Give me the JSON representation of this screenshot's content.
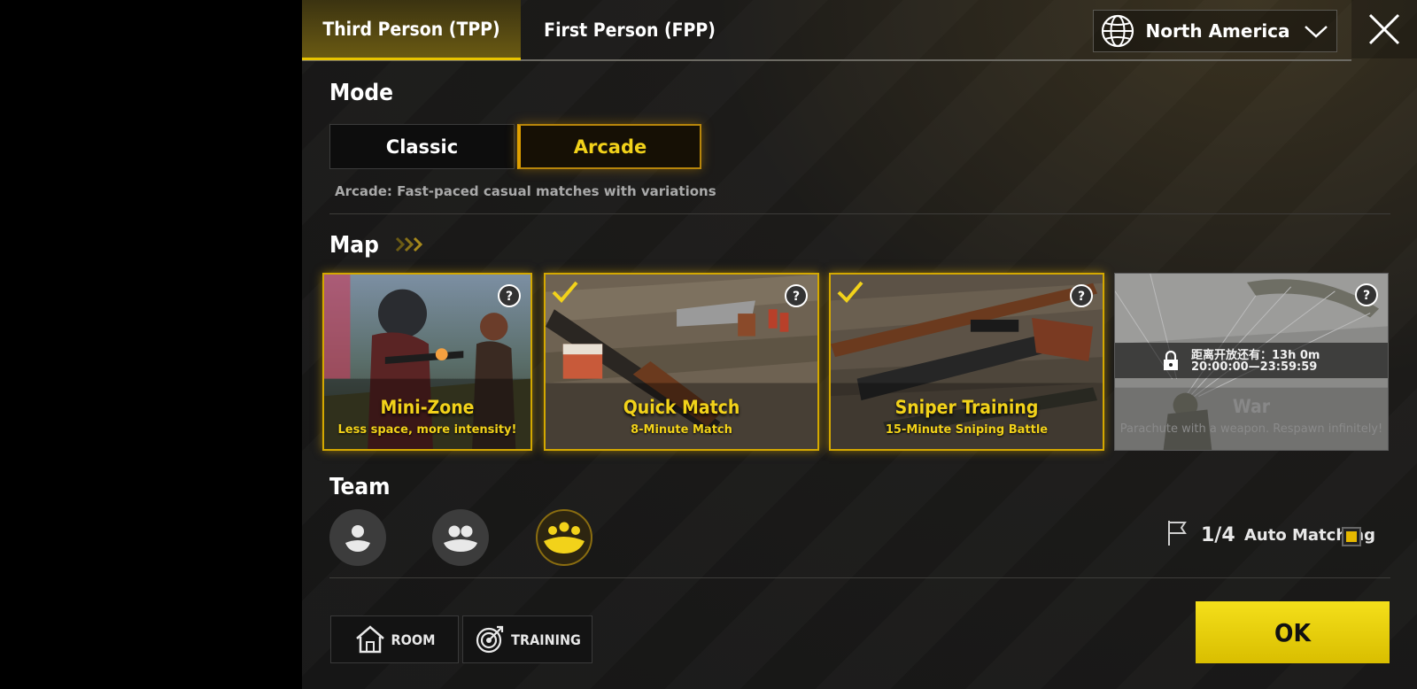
{
  "header": {
    "tabs": [
      {
        "label": "Third Person (TPP)",
        "active": true
      },
      {
        "label": "First Person (FPP)",
        "active": false
      }
    ],
    "region": "North America"
  },
  "mode": {
    "heading": "Mode",
    "options": [
      {
        "label": "Classic",
        "selected": false
      },
      {
        "label": "Arcade",
        "selected": true
      }
    ],
    "description": "Arcade: Fast-paced casual matches with variations"
  },
  "map": {
    "heading": "Map",
    "cards": [
      {
        "title": "Mini-Zone",
        "subtitle": "Less space, more intensity!",
        "selected": false,
        "locked": false
      },
      {
        "title": "Quick Match",
        "subtitle": "8-Minute Match",
        "selected": true,
        "locked": false
      },
      {
        "title": "Sniper Training",
        "subtitle": "15-Minute Sniping Battle",
        "selected": true,
        "locked": false
      },
      {
        "title": "War",
        "subtitle": "Parachute with a weapon. Respawn infinitely!",
        "selected": false,
        "locked": true,
        "lock_line1": "距离开放还有：13h 0m",
        "lock_line2": "20:00:00—23:59:59"
      }
    ]
  },
  "team": {
    "heading": "Team",
    "options": [
      "solo",
      "duo",
      "squad"
    ],
    "selected": "squad",
    "count": "1/4",
    "auto_matching_label": "Auto Matching",
    "auto_matching": true
  },
  "footer": {
    "room_label": "ROOM",
    "training_label": "TRAINING",
    "ok_label": "OK"
  },
  "colors": {
    "accent": "#f2d21a",
    "ok_button": "#e6ca00",
    "panel_bg": "#1a1a1a"
  }
}
